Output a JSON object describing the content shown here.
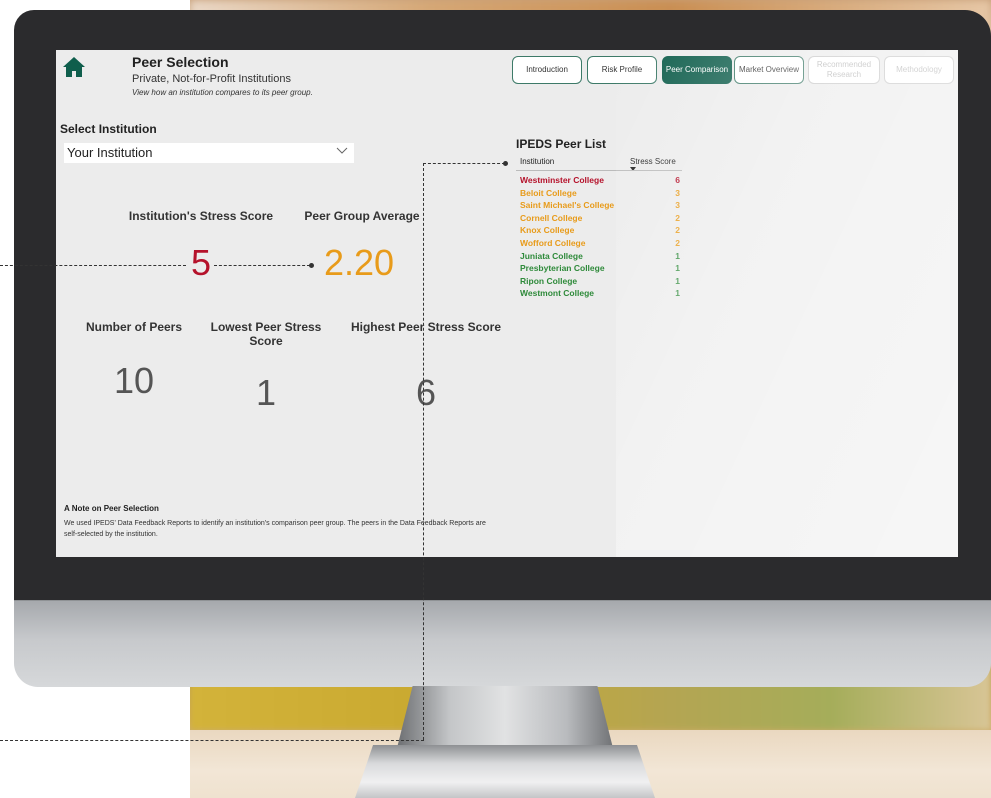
{
  "header": {
    "title": "Peer Selection",
    "subtitle": "Private, Not-for-Profit Institutions",
    "description": "View how an institution compares to its peer group."
  },
  "nav": [
    {
      "label": "Introduction",
      "state": "normal"
    },
    {
      "label": "Risk Profile",
      "state": "normal"
    },
    {
      "label": "Peer Comparison",
      "state": "active"
    },
    {
      "label": "Market Overview",
      "state": "normal"
    },
    {
      "label": "Recommended Research",
      "state": "disabled"
    },
    {
      "label": "Methodology",
      "state": "disabled"
    }
  ],
  "select": {
    "label": "Select Institution",
    "value": "Your Institution"
  },
  "metrics": {
    "stress_label": "Institution's Stress Score",
    "stress_value": "5",
    "avg_label": "Peer Group Average",
    "avg_value": "2.20",
    "peers_label": "Number of Peers",
    "peers_value": "10",
    "lowest_label": "Lowest Peer Stress Score",
    "lowest_value": "1",
    "highest_label": "Highest Peer Stress Score",
    "highest_value": "6"
  },
  "peer_list": {
    "title": "IPEDS Peer List",
    "col_institution": "Institution",
    "col_score": "Stress Score",
    "rows": [
      {
        "name": "Westminster College",
        "score": "6",
        "level": "high"
      },
      {
        "name": "Beloit College",
        "score": "3",
        "level": "mid"
      },
      {
        "name": "Saint Michael's College",
        "score": "3",
        "level": "mid"
      },
      {
        "name": "Cornell College",
        "score": "2",
        "level": "mid"
      },
      {
        "name": "Knox College",
        "score": "2",
        "level": "mid"
      },
      {
        "name": "Wofford College",
        "score": "2",
        "level": "mid"
      },
      {
        "name": "Juniata College",
        "score": "1",
        "level": "low"
      },
      {
        "name": "Presbyterian College",
        "score": "1",
        "level": "low"
      },
      {
        "name": "Ripon College",
        "score": "1",
        "level": "low"
      },
      {
        "name": "Westmont College",
        "score": "1",
        "level": "low"
      }
    ]
  },
  "note": {
    "title": "A Note on Peer Selection",
    "text": "We used IPEDS' Data Feedback Reports to identify an institution's comparison peer group. The peers in the Data Feedback Reports are self-selected by the institution."
  },
  "colors": {
    "high": "#b5122b",
    "mid": "#e89b1a",
    "low": "#2e8a3a",
    "brand": "#0f5e4c"
  }
}
